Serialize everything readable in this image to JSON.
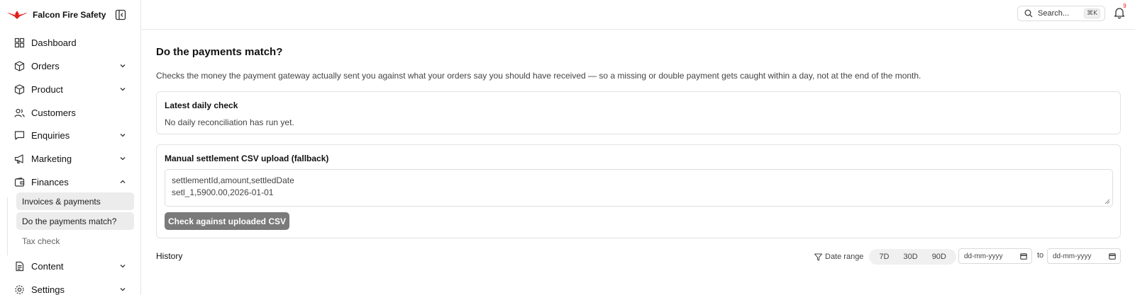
{
  "brand": {
    "name": "Falcon Fire Safety",
    "accent": "#e11d1d"
  },
  "sidebar": {
    "items": [
      {
        "label": "Dashboard",
        "icon": "dashboard-icon",
        "expandable": false
      },
      {
        "label": "Orders",
        "icon": "box-icon",
        "expandable": true
      },
      {
        "label": "Product",
        "icon": "box-icon",
        "expandable": true
      },
      {
        "label": "Customers",
        "icon": "users-icon",
        "expandable": false
      },
      {
        "label": "Enquiries",
        "icon": "message-icon",
        "expandable": true
      },
      {
        "label": "Marketing",
        "icon": "megaphone-icon",
        "expandable": true
      },
      {
        "label": "Finances",
        "icon": "wallet-icon",
        "expandable": true,
        "expanded": true
      },
      {
        "label": "Content",
        "icon": "document-icon",
        "expandable": true
      },
      {
        "label": "Settings",
        "icon": "gear-icon",
        "expandable": true
      }
    ],
    "finance_subitems": [
      {
        "label": "Invoices & payments",
        "state": "highlighted"
      },
      {
        "label": "Do the payments match?",
        "state": "active"
      },
      {
        "label": "Tax check",
        "state": "muted"
      }
    ]
  },
  "topbar": {
    "search_placeholder": "Search...",
    "search_shortcut": "⌘K",
    "notification_count": "9"
  },
  "main": {
    "title": "Do the payments match?",
    "description": "Checks the money the payment gateway actually sent you against what your orders say you should have received — so a missing or double payment gets caught within a day, not at the end of the month.",
    "latest_check": {
      "title": "Latest daily check",
      "body": "No daily reconciliation has run yet."
    },
    "manual_upload": {
      "title": "Manual settlement CSV upload (fallback)",
      "csv_value": "settlementId,amount,settledDate\nsetl_1,5900.00,2026-01-01",
      "button_label": "Check against uploaded CSV"
    },
    "history": {
      "label": "History",
      "filter_label": "Date range",
      "ranges": [
        "7D",
        "30D",
        "90D"
      ],
      "from_placeholder": "dd-mm-yyyy",
      "to_label": "to",
      "to_placeholder": "dd-mm-yyyy"
    }
  }
}
